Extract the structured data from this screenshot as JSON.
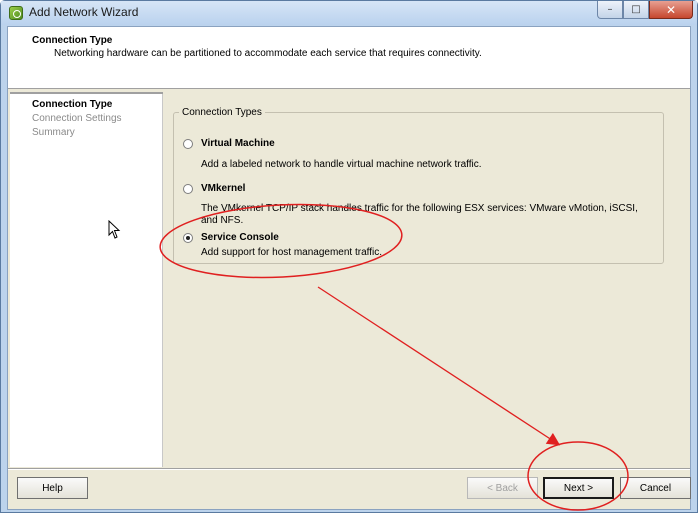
{
  "window": {
    "title": "Add Network Wizard",
    "caption_buttons": {
      "minimize": "–",
      "maximize": "□",
      "close": "✕"
    }
  },
  "header": {
    "title": "Connection Type",
    "description": "Networking hardware can be partitioned to accommodate each service that requires connectivity."
  },
  "nav": {
    "items": [
      {
        "label": "Connection Type",
        "active": true
      },
      {
        "label": "Connection Settings",
        "active": false
      },
      {
        "label": "Summary",
        "active": false
      }
    ]
  },
  "group": {
    "legend": "Connection Types",
    "options": [
      {
        "label": "Virtual Machine",
        "description": "Add a labeled network to handle virtual machine network traffic.",
        "checked": false
      },
      {
        "label": "VMkernel",
        "description": "The VMkernel TCP/IP stack handles traffic for the following ESX services: VMware vMotion, iSCSI, and NFS.",
        "checked": false
      },
      {
        "label": "Service Console",
        "description": "Add support for host management traffic.",
        "checked": true
      }
    ]
  },
  "footer": {
    "help_label": "Help",
    "back_label": "< Back",
    "next_label": "Next >",
    "cancel_label": "Cancel"
  },
  "colors": {
    "annotation": "#e02020",
    "titlebar": "#bad2ee",
    "dialog_bg": "#ece9d8"
  }
}
